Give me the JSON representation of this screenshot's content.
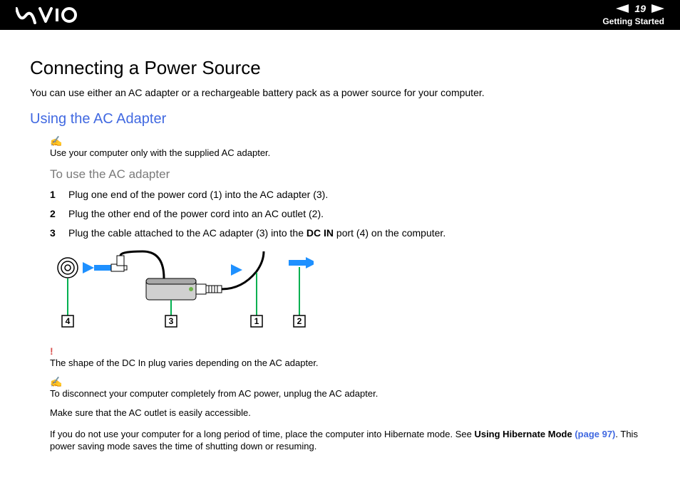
{
  "header": {
    "page_number": "19",
    "section": "Getting Started"
  },
  "title": "Connecting a Power Source",
  "intro": "You can use either an AC adapter or a rechargeable battery pack as a power source for your computer.",
  "subheading": "Using the AC Adapter",
  "note1": "Use your computer only with the supplied AC adapter.",
  "procedure_heading": "To use the AC adapter",
  "steps": [
    {
      "n": "1",
      "text_before": "Plug one end of the power cord (1) into the AC adapter (3).",
      "bold": "",
      "text_after": ""
    },
    {
      "n": "2",
      "text_before": "Plug the other end of the power cord into an AC outlet (2).",
      "bold": "",
      "text_after": ""
    },
    {
      "n": "3",
      "text_before": "Plug the cable attached to the AC adapter (3) into the ",
      "bold": "DC IN",
      "text_after": " port (4) on the computer."
    }
  ],
  "callouts": [
    "4",
    "3",
    "1",
    "2"
  ],
  "caution": "The shape of the DC In plug varies depending on the AC adapter.",
  "note2": "To disconnect your computer completely from AC power, unplug the AC adapter.",
  "note3": "Make sure that the AC outlet is easily accessible.",
  "note4_before": "If you do not use your computer for a long period of time, place the computer into Hibernate mode. See ",
  "note4_link_label": "Using Hibernate Mode ",
  "note4_link_page": "(page 97)",
  "note4_after": ". This power saving mode saves the time of shutting down or resuming."
}
